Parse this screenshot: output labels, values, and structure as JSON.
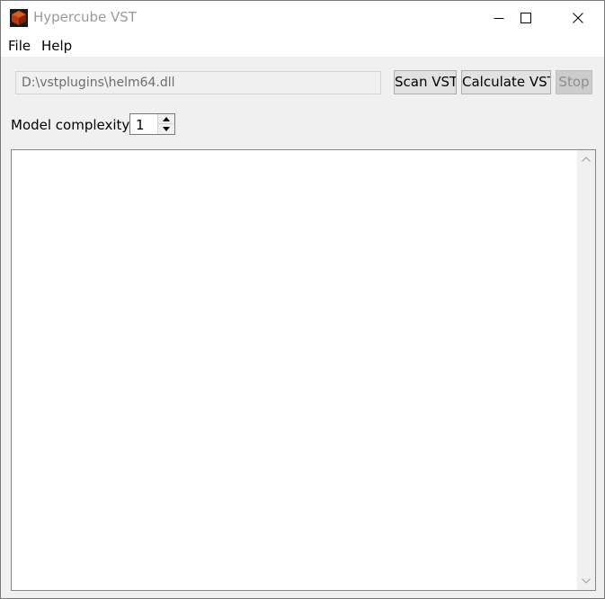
{
  "window": {
    "title": "Hypercube VST"
  },
  "menu": {
    "file": "File",
    "help": "Help"
  },
  "toolbar": {
    "path_value": "D:\\vstplugins\\helm64.dll",
    "scan_label": "Scan VST",
    "calculate_label": "Calculate VST",
    "stop_label": "Stop"
  },
  "model": {
    "label": "Model complexity:",
    "value": "1"
  },
  "output": {
    "text": ""
  },
  "icons": {
    "app": "hypercube-app-icon",
    "minimize": "minimize-icon",
    "maximize": "maximize-icon",
    "close": "close-icon"
  }
}
